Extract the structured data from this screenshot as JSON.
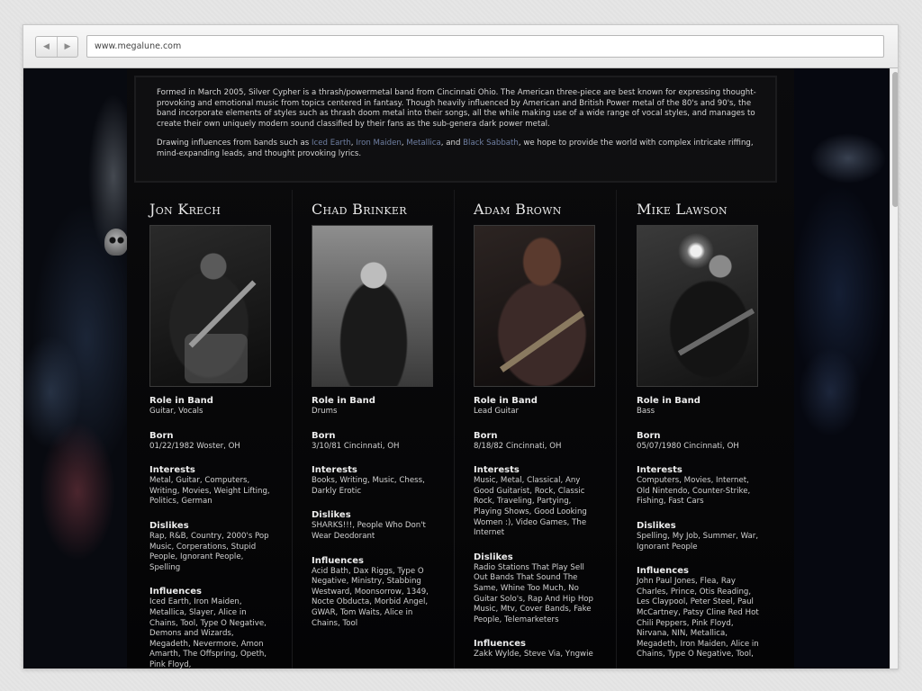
{
  "browser": {
    "url": "www.megalune.com",
    "back_glyph": "◀",
    "forward_glyph": "▶"
  },
  "intro": {
    "paragraph1": "Formed in March 2005, Silver Cypher is a thrash/powermetal band from Cincinnati Ohio. The American three-piece are best known for expressing thought-provoking and emotional music from topics centered in fantasy. Though heavily influenced by American and British Power metal of the 80's and 90's, the band incorporate elements of styles such as thrash doom metal into their songs, all the while making use of a wide range of vocal styles, and manages to create their own uniquely modern sound classified by their fans as the sub-genera dark power metal.",
    "p2_lead": "Drawing influences from bands such as ",
    "links": [
      "Iced Earth",
      "Iron Maiden",
      "Metallica",
      "Black Sabbath"
    ],
    "sep1": ", ",
    "sep2": ", ",
    "sep3": ", and ",
    "p2_tail": ", we hope to provide the world with complex intricate riffing, mind-expanding leads, and thought provoking lyrics."
  },
  "colors": {
    "link": "#6f7fa2",
    "text": "#d6d6d6",
    "background": "#05060a"
  },
  "members": [
    {
      "name": "Jon Krech",
      "fields": [
        {
          "label": "Role in Band",
          "value": "Guitar, Vocals"
        },
        {
          "label": "Born",
          "value": "01/22/1982 Woster, OH"
        },
        {
          "label": "Interests",
          "value": "Metal, Guitar, Computers, Writing, Movies, Weight Lifting, Politics, German"
        },
        {
          "label": "Dislikes",
          "value": "Rap, R&B, Country, 2000's Pop Music, Corperations, Stupid People, Ignorant People, Spelling"
        },
        {
          "label": "Influences",
          "value": "Iced Earth, Iron Maiden, Metallica, Slayer, Alice in Chains, Tool, Type O Negative, Demons and Wizards, Megadeth, Nevermore, Amon Amarth, The Offspring, Opeth, Pink Floyd,"
        }
      ]
    },
    {
      "name": "Chad Brinker",
      "fields": [
        {
          "label": "Role in Band",
          "value": "Drums"
        },
        {
          "label": "Born",
          "value": "3/10/81 Cincinnati, OH"
        },
        {
          "label": "Interests",
          "value": "Books, Writing, Music, Chess, Darkly Erotic"
        },
        {
          "label": "Dislikes",
          "value": "SHARKS!!!, People Who Don't Wear Deodorant"
        },
        {
          "label": "Influences",
          "value": "Acid Bath, Dax Riggs, Type O Negative, Ministry, Stabbing Westward, Moonsorrow, 1349, Nocte Obducta, Morbid Angel, GWAR, Tom Waits, Alice in Chains, Tool"
        }
      ]
    },
    {
      "name": "Adam Brown",
      "fields": [
        {
          "label": "Role in Band",
          "value": "Lead Guitar"
        },
        {
          "label": "Born",
          "value": "8/18/82 Cincinnati, OH"
        },
        {
          "label": "Interests",
          "value": "Music, Metal, Classical, Any Good Guitarist, Rock, Classic Rock, Traveling, Partying, Playing Shows, Good Looking Women :), Video Games, The Internet"
        },
        {
          "label": "Dislikes",
          "value": "Radio Stations That Play Sell Out Bands That Sound The Same, Whine Too Much, No Guitar Solo's, Rap And Hip Hop Music, Mtv, Cover Bands, Fake People, Telemarketers"
        },
        {
          "label": "Influences",
          "value": "Zakk Wylde, Steve Via, Yngwie"
        }
      ]
    },
    {
      "name": "Mike Lawson",
      "fields": [
        {
          "label": "Role in Band",
          "value": "Bass"
        },
        {
          "label": "Born",
          "value": "05/07/1980 Cincinnati, OH"
        },
        {
          "label": "Interests",
          "value": "Computers, Movies, Internet, Old Nintendo, Counter-Strike, Fishing, Fast Cars"
        },
        {
          "label": "Dislikes",
          "value": "Spelling, My Job, Summer, War, Ignorant People"
        },
        {
          "label": "Influences",
          "value": "John Paul Jones, Flea, Ray Charles, Prince, Otis Reading, Les Claypool, Peter Steel, Paul McCartney, Patsy Cline Red Hot Chili Peppers, Pink Floyd, Nirvana, NIN, Metallica, Megadeth, Iron Maiden, Alice in Chains, Type O Negative, Tool,"
        }
      ]
    }
  ]
}
